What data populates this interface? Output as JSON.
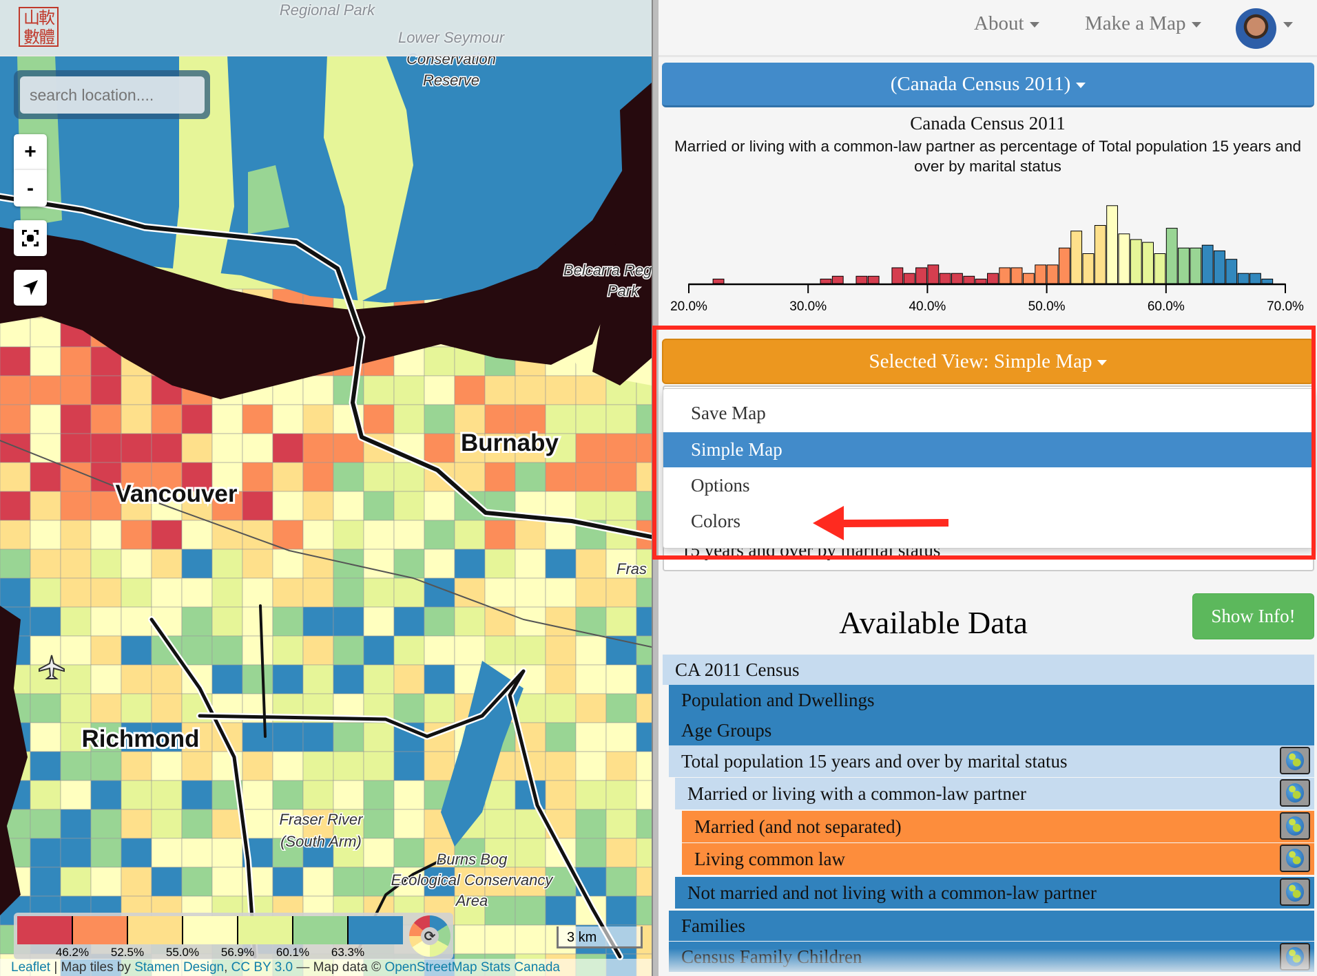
{
  "map": {
    "logo_text": "山軟數體",
    "search_placeholder": "search location....",
    "zoom_in": "+",
    "zoom_out": "-",
    "place_labels": {
      "regional_park": "Regional Park",
      "lower_seymour": "Lower Seymour",
      "conservation": "Conservation",
      "reserve": "Reserve",
      "belcarra": "Belcarra Reg",
      "park": "Park",
      "fras": "Fras",
      "fraser_river": "Fraser River",
      "south_arm": "(South Arm)",
      "burns_bog": "Burns Bog",
      "eco_conservancy": "Ecological Conservancy",
      "area": "Area",
      "burnaby": "Burnaby",
      "vancouver": "Vancouver",
      "richmond": "Richmond"
    },
    "legend": {
      "colors": [
        "#d53e4f",
        "#fc8d59",
        "#fee08b",
        "#ffffbf",
        "#e6f598",
        "#99d594",
        "#3288bd"
      ],
      "breaks": [
        "46.2%",
        "52.5%",
        "55.0%",
        "56.9%",
        "60.1%",
        "63.3%"
      ]
    },
    "scale_label": "3 km",
    "attribution": {
      "leaflet": "Leaflet",
      "sep1": " | Map tiles by ",
      "stamen": "Stamen Design",
      "sep2": ", ",
      "cc": "CC BY 3.0",
      "sep3": " — Map data © ",
      "osm": "OpenStreetMap",
      "sep4": " ",
      "stats": "Stats Canada"
    }
  },
  "nav": {
    "about": "About",
    "make_map": "Make a Map"
  },
  "dataset_button": "(Canada Census 2011)",
  "chart_data": {
    "type": "bar",
    "title": "Canada Census 2011",
    "subtitle": "Married or living with a common-law partner as percentage of Total population 15 years and over by marital status",
    "xlabel": "",
    "ylabel": "",
    "xlim": [
      20,
      70
    ],
    "tick_labels": [
      "20.0%",
      "30.0%",
      "40.0%",
      "50.0%",
      "60.0%",
      "70.0%"
    ],
    "ticks": [
      20,
      30,
      40,
      50,
      60,
      70
    ],
    "bin_width": 1,
    "bins": [
      22,
      31,
      32,
      34,
      35,
      37,
      38,
      39,
      40,
      41,
      42,
      43,
      44,
      45,
      46,
      47,
      48,
      49,
      50,
      51,
      52,
      53,
      54,
      55,
      56,
      57,
      58,
      59,
      60,
      61,
      62,
      63,
      64,
      65,
      66,
      67,
      68
    ],
    "counts": [
      1,
      1,
      2,
      2,
      2,
      5,
      3,
      5,
      6,
      3,
      3,
      2,
      1,
      3,
      5,
      5,
      3,
      6,
      6,
      12,
      18,
      10,
      20,
      27,
      17,
      15,
      14,
      10,
      19,
      12,
      12,
      13,
      11,
      8,
      3,
      3,
      1
    ],
    "color_thresholds": [
      46.2,
      52.5,
      55.0,
      56.9,
      60.1,
      63.3
    ]
  },
  "view_button": "Selected View: Simple Map",
  "view_menu": [
    "Save Map",
    "Simple Map",
    "Options",
    "Colors"
  ],
  "view_menu_active": 1,
  "textarea_text": "15 years and over by marital status",
  "available_data": {
    "title": "Available Data",
    "show_info": "Show Info!",
    "rows": [
      {
        "label": "CA 2011 Census",
        "globe": false
      },
      {
        "label": "Population and Dwellings",
        "globe": false
      },
      {
        "label": "Age Groups",
        "globe": false
      },
      {
        "label": "Total population 15 years and over by marital status",
        "globe": true
      },
      {
        "label": "Married or living with a common-law partner",
        "globe": true
      },
      {
        "label": "Married (and not separated)",
        "globe": true
      },
      {
        "label": "Living common law",
        "globe": true
      },
      {
        "label": "Not married and not living with a common-law partner",
        "globe": true
      },
      {
        "label": "Families",
        "globe": false
      },
      {
        "label": "Census Family Children",
        "globe": true
      }
    ]
  },
  "colors": {
    "primary": "#428bca",
    "warning": "#ec971f",
    "success": "#5cb85c",
    "row_light": "#c6dbef",
    "row_dark": "#3182bd",
    "row_orange": "#fd8d3c",
    "annotation": "#ff2a1f"
  }
}
